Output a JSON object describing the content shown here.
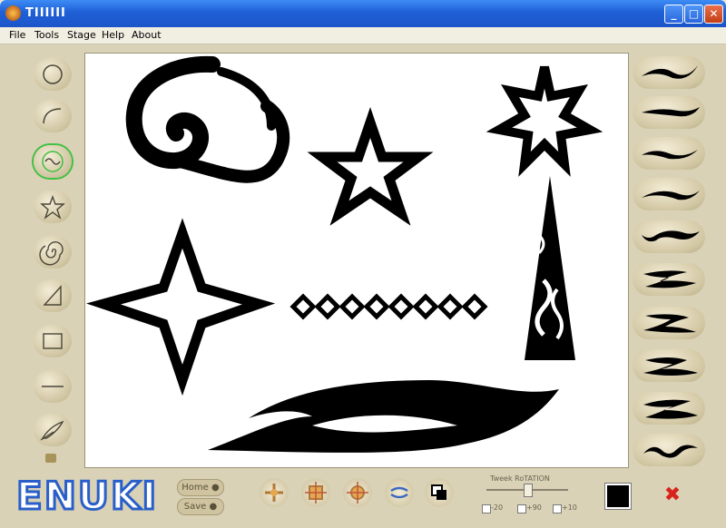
{
  "window": {
    "title": "TIIIIII"
  },
  "menu": [
    "File",
    "Tools",
    "Stage",
    "Help",
    "About"
  ],
  "tools": [
    {
      "name": "circle-tool",
      "icon": "circle-icon"
    },
    {
      "name": "arc-tool",
      "icon": "arc-icon"
    },
    {
      "name": "wave-tool",
      "icon": "wave-icon",
      "active": true
    },
    {
      "name": "star-tool",
      "icon": "star-icon"
    },
    {
      "name": "spiral-tool",
      "icon": "spiral-icon"
    },
    {
      "name": "triangle-tool",
      "icon": "triangle-icon"
    },
    {
      "name": "rectangle-tool",
      "icon": "rectangle-icon"
    },
    {
      "name": "line-tool",
      "icon": "line-icon"
    },
    {
      "name": "feather-tool",
      "icon": "feather-icon"
    }
  ],
  "bottom": {
    "home_label": "Home",
    "save_label": "Save",
    "slider_label": "Tweek RoTATION",
    "check_labels": [
      "-20",
      "+90",
      "+10"
    ],
    "logo_text": "ENUKI"
  },
  "colors": {
    "accent_active": "#41c041",
    "titlebar": "#1f5fd6",
    "ink": "#000000"
  }
}
